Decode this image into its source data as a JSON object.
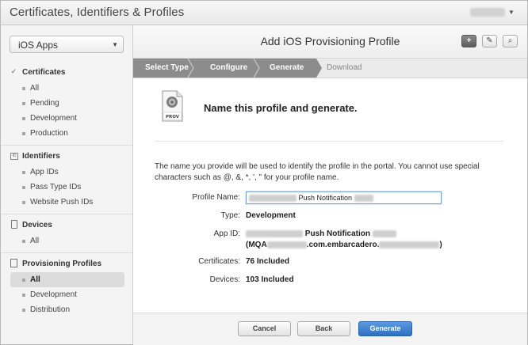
{
  "app": {
    "title": "Certificates, Identifiers & Profiles"
  },
  "sidebar": {
    "platform": "iOS Apps",
    "sections": [
      {
        "title": "Certificates",
        "icon": "certificate-icon",
        "items": [
          "All",
          "Pending",
          "Development",
          "Production"
        ]
      },
      {
        "title": "Identifiers",
        "icon": "id-icon",
        "items": [
          "App IDs",
          "Pass Type IDs",
          "Website Push IDs"
        ]
      },
      {
        "title": "Devices",
        "icon": "device-icon",
        "items": [
          "All"
        ]
      },
      {
        "title": "Provisioning Profiles",
        "icon": "document-icon",
        "items": [
          "All",
          "Development",
          "Distribution"
        ]
      }
    ],
    "active": "Provisioning Profiles / All"
  },
  "main": {
    "title": "Add iOS Provisioning Profile",
    "steps": [
      "Select Type",
      "Configure",
      "Generate",
      "Download"
    ],
    "icon_label": "PROV",
    "heading": "Name this profile and generate.",
    "description": "The name you provide will be used to identify the profile in the portal. You cannot use special characters such as @, &, *, ', \" for your profile name.",
    "fields": {
      "profile_name": {
        "label": "Profile Name:",
        "value": "Push Notification"
      },
      "type": {
        "label": "Type:",
        "value": "Development"
      },
      "app_id": {
        "label": "App ID:",
        "value": "Push Notification",
        "value2_prefix": "(MQA",
        "value2_mid": ".com.embarcadero.",
        "value2_suffix": ")"
      },
      "certificates": {
        "label": "Certificates:",
        "value": "76 Included"
      },
      "devices": {
        "label": "Devices:",
        "value": "103 Included"
      }
    }
  },
  "toolbar": {
    "add": "+",
    "edit": "✎",
    "search": "⌕"
  },
  "footer": {
    "cancel": "Cancel",
    "back": "Back",
    "generate": "Generate"
  },
  "colors": {
    "accent": "#3a78c8",
    "step_done": "#8c8c8c",
    "step_todo": "#eaeaea"
  }
}
